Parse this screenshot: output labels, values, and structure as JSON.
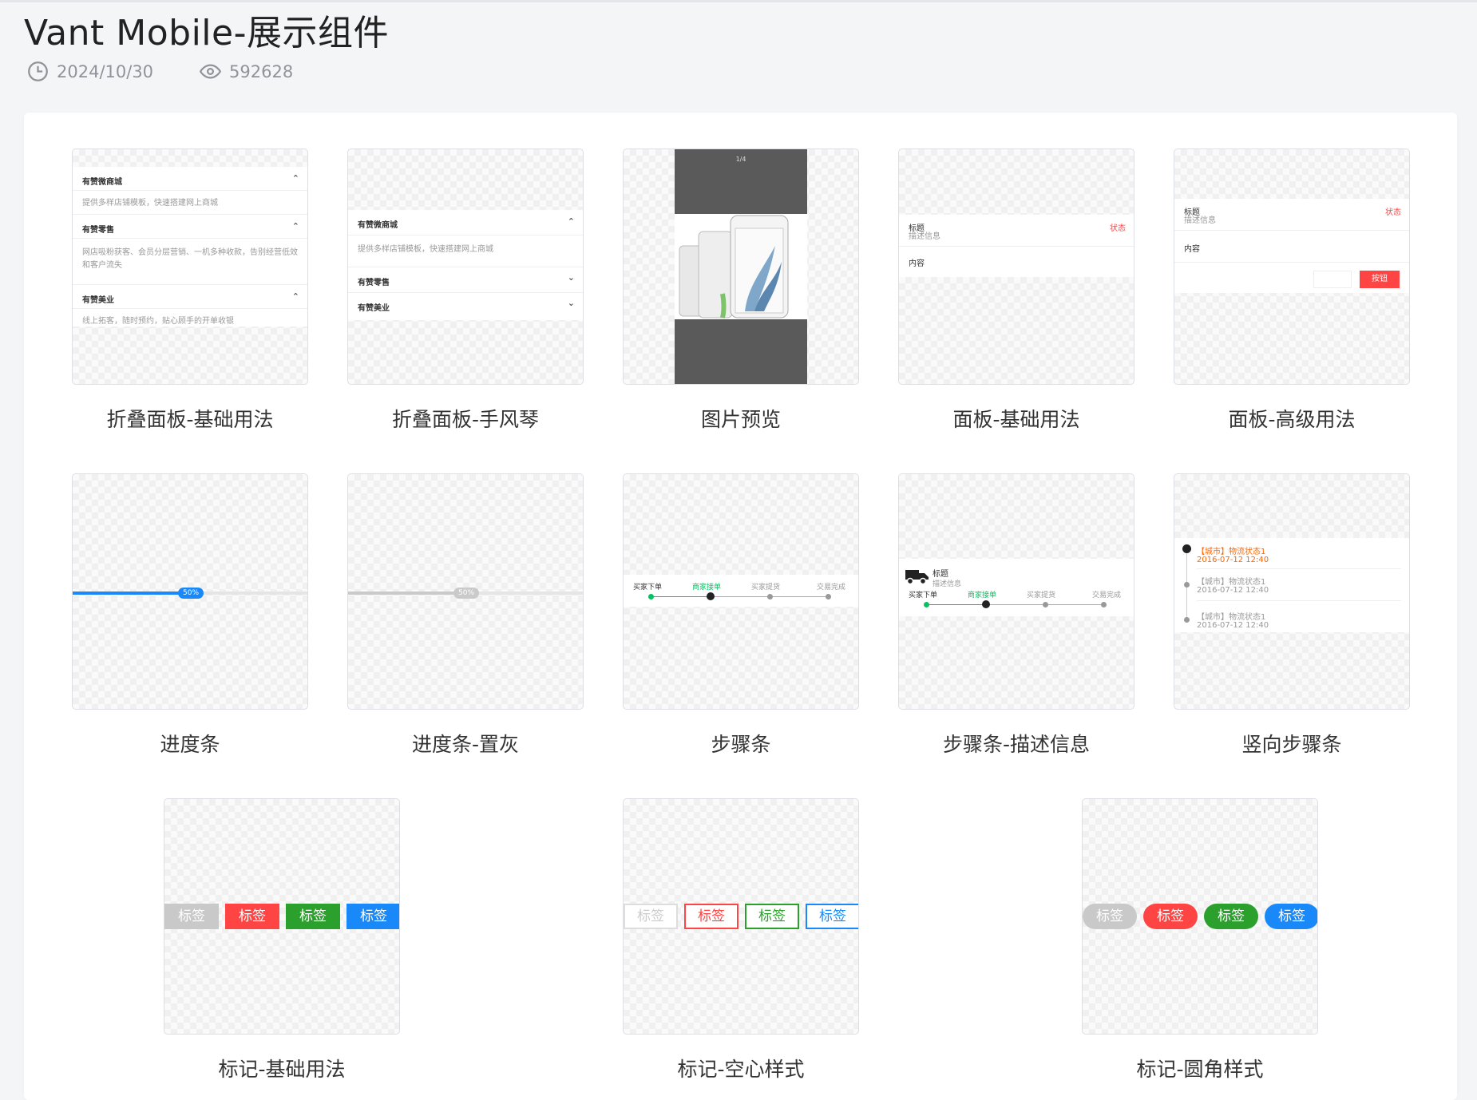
{
  "page": {
    "title": "Vant Mobile-展示组件",
    "date": "2024/10/30",
    "views": "592628"
  },
  "cards": {
    "collapse_basic": {
      "caption": "折叠面板-基础用法",
      "items": [
        {
          "title": "有赞微商城",
          "desc": "提供多样店铺模板，快速搭建网上商城"
        },
        {
          "title": "有赞零售",
          "desc": "网店吸粉获客、会员分层营销、一机多种收款，告别经营低效和客户流失"
        },
        {
          "title": "有赞美业",
          "desc": "线上拓客，随时预约，贴心顾手的开单收银"
        }
      ]
    },
    "collapse_accordion": {
      "caption": "折叠面板-手风琴",
      "items": [
        {
          "title": "有赞微商城",
          "desc": "提供多样店铺模板，快速搭建网上商城"
        },
        {
          "title": "有赞零售"
        },
        {
          "title": "有赞美业"
        }
      ]
    },
    "image_preview": {
      "caption": "图片预览",
      "counter": "1/4"
    },
    "panel_basic": {
      "caption": "面板-基础用法",
      "title": "标题",
      "desc": "描述信息",
      "status": "状态",
      "content": "内容"
    },
    "panel_advanced": {
      "caption": "面板-高级用法",
      "title": "标题",
      "desc": "描述信息",
      "status": "状态",
      "content": "内容",
      "button": "按钮"
    },
    "progress": {
      "caption": "进度条",
      "percent_label": "50%",
      "value": 0.5
    },
    "progress_gray": {
      "caption": "进度条-置灰",
      "percent_label": "50%",
      "value": 0.5
    },
    "steps": {
      "caption": "步骤条",
      "labels": [
        "买家下单",
        "商家接单",
        "买家提货",
        "交易完成"
      ],
      "active": 1
    },
    "steps_desc": {
      "caption": "步骤条-描述信息",
      "title": "标题",
      "desc": "描述信息",
      "labels": [
        "买家下单",
        "商家接单",
        "买家提货",
        "交易完成"
      ],
      "active": 1
    },
    "steps_vertical": {
      "caption": "竖向步骤条",
      "items": [
        {
          "text": "【城市】物流状态1",
          "time": "2016-07-12 12:40"
        },
        {
          "text": "【城市】物流状态1",
          "time": "2016-07-12 12:40"
        },
        {
          "text": "【城市】物流状态1",
          "time": "2016-07-12 12:40"
        }
      ]
    },
    "tag_basic": {
      "caption": "标记-基础用法",
      "tags": [
        "标签",
        "标签",
        "标签",
        "标签"
      ]
    },
    "tag_plain": {
      "caption": "标记-空心样式",
      "tags": [
        "标签",
        "标签",
        "标签",
        "标签"
      ]
    },
    "tag_round": {
      "caption": "标记-圆角样式",
      "tags": [
        "标签",
        "标签",
        "标签",
        "标签"
      ]
    }
  },
  "colors": {
    "blue": "#1989fa",
    "red": "#f44",
    "green": "#2ca02c",
    "gray": "#c9c9c9",
    "step_green": "#07c160",
    "orange": "#ff6600"
  },
  "icons": {
    "date": "clock-icon",
    "views": "eye-icon"
  }
}
